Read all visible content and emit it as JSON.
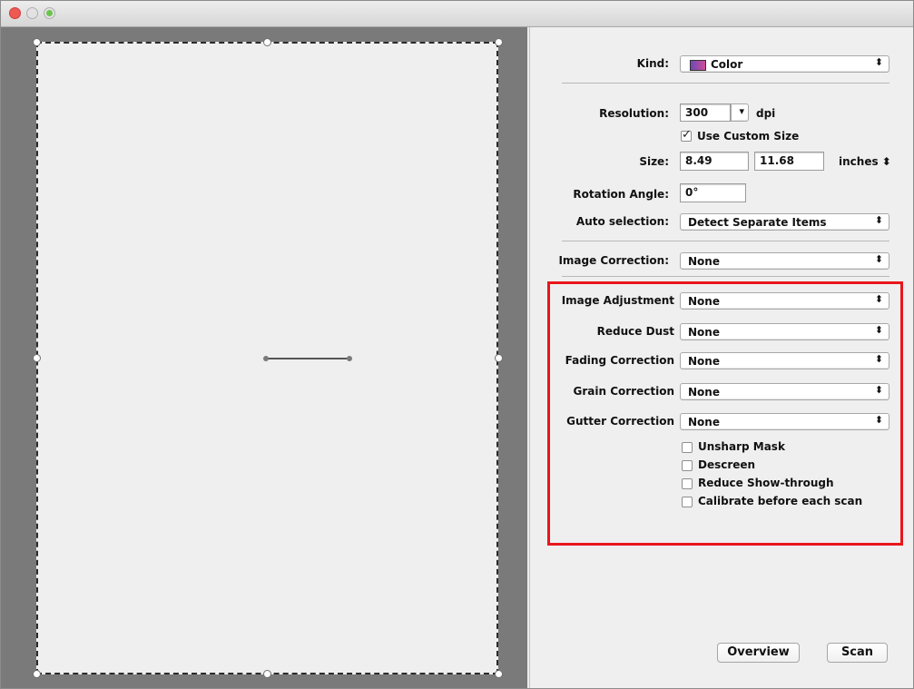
{
  "panel": {
    "kind": {
      "label": "Kind:",
      "value": "Color"
    },
    "resolution": {
      "label": "Resolution:",
      "value": "300",
      "unit": "dpi"
    },
    "use_custom_size": {
      "label": "Use Custom Size",
      "checked": true
    },
    "size": {
      "label": "Size:",
      "width": "8.49",
      "height": "11.68",
      "unit": "inches"
    },
    "rotation": {
      "label": "Rotation Angle:",
      "value": "0°"
    },
    "auto_selection": {
      "label": "Auto selection:",
      "value": "Detect Separate Items"
    },
    "image_correction": {
      "label": "Image Correction:",
      "value": "None"
    },
    "image_adjustment": {
      "label": "Image Adjustment",
      "value": "None"
    },
    "reduce_dust": {
      "label": "Reduce Dust",
      "value": "None"
    },
    "fading_correction": {
      "label": "Fading Correction",
      "value": "None"
    },
    "grain_correction": {
      "label": "Grain Correction",
      "value": "None"
    },
    "gutter_correction": {
      "label": "Gutter Correction",
      "value": "None"
    },
    "checkboxes": [
      {
        "label": "Unsharp Mask",
        "checked": false
      },
      {
        "label": "Descreen",
        "checked": false
      },
      {
        "label": "Reduce Show-through",
        "checked": false
      },
      {
        "label": "Calibrate before each scan",
        "checked": false
      }
    ],
    "overview_button": "Overview",
    "scan_button": "Scan"
  },
  "icons": {
    "popup_arrows": "⬍",
    "dropdown_arrow": "▾"
  },
  "colors": {
    "highlight": "#e8161b",
    "close": "#ee5a53",
    "zoom": "#6cc44b"
  }
}
